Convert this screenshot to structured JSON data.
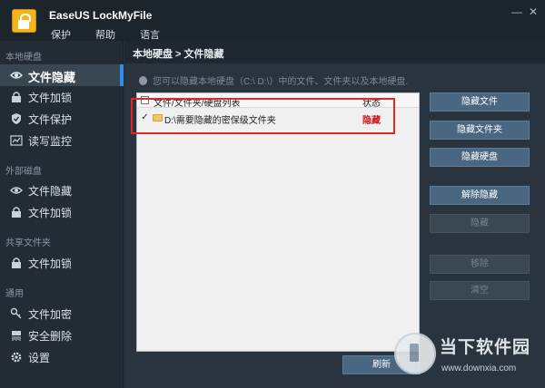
{
  "app": {
    "title": "EaseUS LockMyFile"
  },
  "menu": [
    "保护",
    "帮助",
    "语言"
  ],
  "sidebar": {
    "sections": [
      {
        "title": "本地硬盘",
        "items": [
          {
            "label": "文件隐藏",
            "icon": "eye-icon",
            "active": true
          },
          {
            "label": "文件加锁",
            "icon": "lock-icon"
          },
          {
            "label": "文件保护",
            "icon": "shield-icon"
          },
          {
            "label": "读写监控",
            "icon": "monitor-chart-icon"
          }
        ]
      },
      {
        "title": "外部磁盘",
        "items": [
          {
            "label": "文件隐藏",
            "icon": "eye-icon"
          },
          {
            "label": "文件加锁",
            "icon": "lock-icon"
          }
        ]
      },
      {
        "title": "共享文件夹",
        "items": [
          {
            "label": "文件加锁",
            "icon": "lock-icon"
          }
        ]
      },
      {
        "title": "通用",
        "items": [
          {
            "label": "文件加密",
            "icon": "key-icon"
          },
          {
            "label": "安全删除",
            "icon": "shredder-icon"
          },
          {
            "label": "设置",
            "icon": "gear-icon"
          }
        ]
      }
    ]
  },
  "main": {
    "breadcrumb": "本地硬盘 > 文件隐藏",
    "hint": "您可以隐藏本地硬盘（C:\\ D:\\）中的文件、文件夹以及本地硬盘.",
    "list": {
      "col_name": "文件/文件夹/硬盘列表",
      "col_status": "状态",
      "rows": [
        {
          "checked": "✓",
          "path": "D:\\需要隐藏的密保级文件夹",
          "status": "隐藏"
        }
      ]
    },
    "buttons": {
      "hide_file": "隐藏文件",
      "hide_folder": "隐藏文件夹",
      "hide_disk": "隐藏硬盘",
      "unhide": "解除隐藏",
      "hide": "隐藏",
      "remove": "移除",
      "clear": "清空",
      "refresh": "刷新"
    }
  },
  "watermark": {
    "name": "当下软件园",
    "url": "www.downxia.com"
  },
  "colors": {
    "accent": "#2f8ee6",
    "status_hidden": "#d0181d",
    "highlight_box": "#e3262a"
  }
}
